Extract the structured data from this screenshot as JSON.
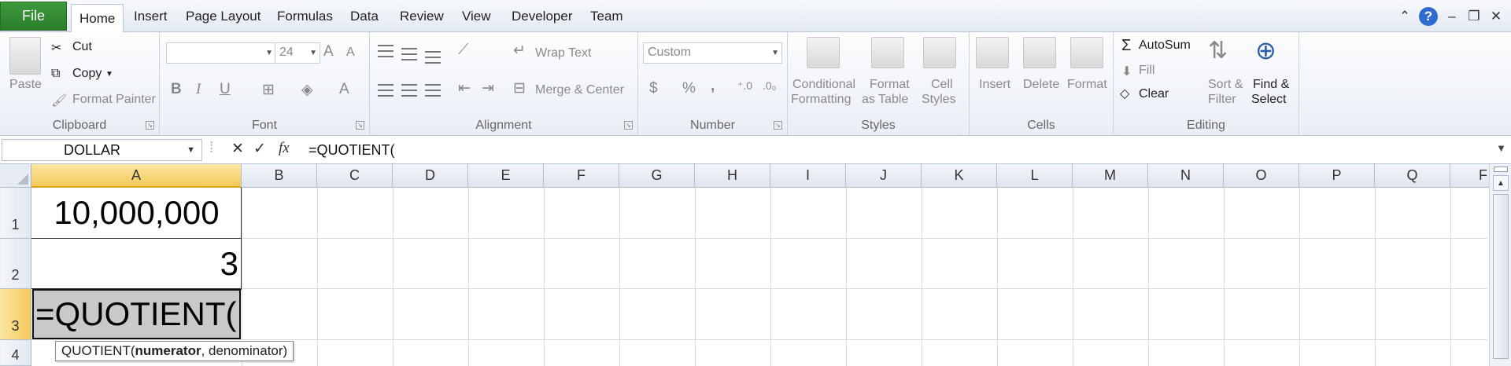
{
  "tabs": {
    "file": "File",
    "items": [
      "Home",
      "Insert",
      "Page Layout",
      "Formulas",
      "Data",
      "Review",
      "View",
      "Developer",
      "Team"
    ],
    "active": "Home"
  },
  "window_controls": {
    "minimize_ribbon": "⌃",
    "help": "?",
    "minimize": "–",
    "restore": "❐",
    "close": "✕"
  },
  "ribbon": {
    "clipboard": {
      "label": "Clipboard",
      "paste": "Paste",
      "cut": "Cut",
      "copy": "Copy",
      "format_painter": "Format Painter"
    },
    "font": {
      "label": "Font",
      "font_name": "",
      "font_size": "24",
      "bold": "B",
      "italic": "I",
      "underline": "U",
      "grow": "A",
      "shrink": "A",
      "color": "A"
    },
    "alignment": {
      "label": "Alignment",
      "wrap_text": "Wrap Text",
      "merge_center": "Merge & Center"
    },
    "number": {
      "label": "Number",
      "format": "Custom",
      "currency": "$",
      "percent": "%",
      "comma": ",",
      "inc_decimal": "←.0\n.00",
      "dec_decimal": ".00\n→.0"
    },
    "styles": {
      "label": "Styles",
      "conditional_1": "Conditional",
      "conditional_2": "Formatting",
      "format_table_1": "Format",
      "format_table_2": "as Table",
      "cell_styles_1": "Cell",
      "cell_styles_2": "Styles"
    },
    "cells": {
      "label": "Cells",
      "insert": "Insert",
      "delete": "Delete",
      "format": "Format"
    },
    "editing": {
      "label": "Editing",
      "autosum": "AutoSum",
      "fill": "Fill",
      "clear": "Clear",
      "sort_1": "Sort &",
      "sort_2": "Filter",
      "find_1": "Find &",
      "find_2": "Select"
    }
  },
  "formula_bar": {
    "name_box": "DOLLAR",
    "cancel": "✕",
    "enter": "✓",
    "fx": "fx",
    "content": "=QUOTIENT("
  },
  "grid": {
    "columns": [
      "A",
      "B",
      "C",
      "D",
      "E",
      "F",
      "G",
      "H",
      "I",
      "J",
      "K",
      "L",
      "M",
      "N",
      "O",
      "P",
      "Q",
      "F"
    ],
    "rows": [
      "1",
      "2",
      "3",
      "4"
    ],
    "cells": {
      "A1": "10,000,000",
      "A2": "3",
      "A3": "=QUOTIENT("
    },
    "tooltip": {
      "func": "QUOTIENT(",
      "arg1": "numerator",
      "rest": ", denominator)"
    }
  }
}
